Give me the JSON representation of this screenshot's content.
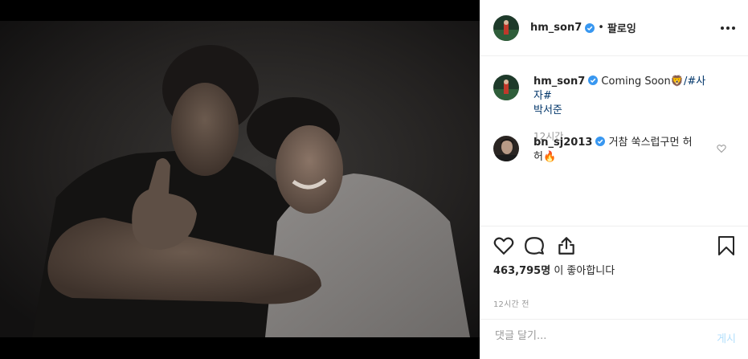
{
  "post": {
    "photo_alt": "",
    "author": "hm_son7",
    "follow_label": "팔로잉",
    "separator": "•"
  },
  "caption": {
    "username": "hm_son7",
    "text": "Coming Soon",
    "emoji": "🦁",
    "hashtags_line1": "/#사자#",
    "hashtags_line2": "박서준",
    "time": "12시간"
  },
  "comment": {
    "username": "bn_sj2013",
    "text_line1": "거참 쑥스럽구먼 허",
    "text_line2": "허",
    "emoji": "🔥"
  },
  "likes": {
    "count": "463,795명",
    "suffix": "이 좋아합니다"
  },
  "post_time": "12시간 전",
  "add_comment": {
    "placeholder": "댓글 달기...",
    "post_label": "게시"
  },
  "colors": {
    "verified": "#3897f0",
    "link": "#003569",
    "post_disabled": "#b2dffc"
  }
}
